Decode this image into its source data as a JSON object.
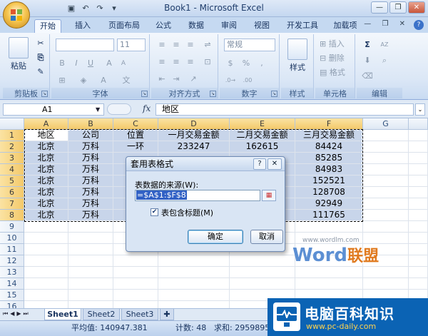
{
  "window": {
    "title": "Book1 - Microsoft Excel",
    "buttons": {
      "minimize": "—",
      "restore": "❐",
      "close": "✕"
    }
  },
  "qat": {
    "save_icon": "save-icon",
    "undo_icon": "undo-icon",
    "redo_icon": "redo-icon"
  },
  "tabs": [
    "开始",
    "插入",
    "页面布局",
    "公式",
    "数据",
    "审阅",
    "视图",
    "开发工具",
    "加载项"
  ],
  "ribbon": {
    "groups": {
      "clipboard": "剪贴板",
      "font": "字体",
      "alignment": "对齐方式",
      "number": "数字",
      "styles": "样式",
      "cells": "单元格",
      "editing": "编辑"
    },
    "paste_label": "粘贴",
    "font_size": "11",
    "number_format": "常规",
    "styles_label": "样式",
    "insert_label": "插入",
    "delete_label": "删除",
    "format_label": "格式",
    "sigma": "Σ",
    "sort": "AZ"
  },
  "formula_bar": {
    "name_box": "A1",
    "fx": "fx",
    "content": "地区"
  },
  "grid": {
    "columns": [
      "A",
      "B",
      "C",
      "D",
      "E",
      "F",
      "G"
    ],
    "rows": [
      "1",
      "2",
      "3",
      "4",
      "5",
      "6",
      "7",
      "8",
      "9",
      "10",
      "11",
      "12",
      "13",
      "14",
      "15",
      "16"
    ],
    "header": [
      "地区",
      "公司",
      "位置",
      "一月交易金额",
      "二月交易金额",
      "三月交易金额"
    ],
    "data": [
      [
        "北京",
        "万科",
        "一环",
        "233247",
        "162615",
        "84424"
      ],
      [
        "北京",
        "万科",
        "",
        "",
        "",
        "85285"
      ],
      [
        "北京",
        "万科",
        "",
        "",
        "",
        "84983"
      ],
      [
        "北京",
        "万科",
        "",
        "",
        "",
        "152521"
      ],
      [
        "北京",
        "万科",
        "",
        "",
        "",
        "128708"
      ],
      [
        "北京",
        "万科",
        "",
        "",
        "",
        "92949"
      ],
      [
        "北京",
        "万科",
        "",
        "",
        "",
        "111765"
      ]
    ]
  },
  "dialog": {
    "title": "套用表格式",
    "help": "?",
    "close": "✕",
    "source_label": "表数据的来源(W):",
    "source_value": "=$A$1:$F$8",
    "has_headers_label": "表包含标题(M)",
    "has_headers_checked": true,
    "ok": "确定",
    "cancel": "取消"
  },
  "watermark": {
    "url": "www.wordlm.com",
    "word": "Word",
    "union": "联盟"
  },
  "sheets": [
    "Sheet1",
    "Sheet2",
    "Sheet3"
  ],
  "status": {
    "average": "平均值: 140947.381",
    "count": "计数: 48",
    "sum": "求和: 2959895"
  },
  "brand": {
    "name": "电脑百科知识",
    "url": "www.pc-daily.com"
  }
}
